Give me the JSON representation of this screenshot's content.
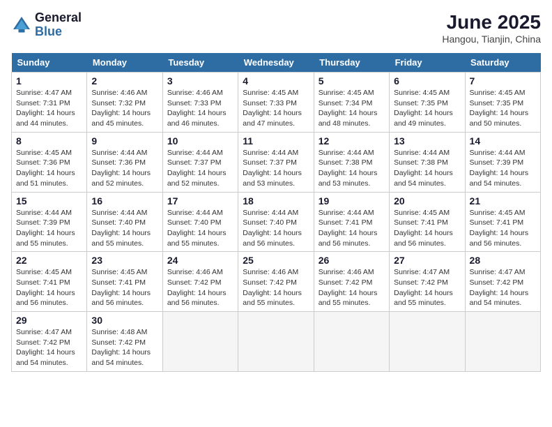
{
  "header": {
    "logo_line1": "General",
    "logo_line2": "Blue",
    "month": "June 2025",
    "location": "Hangou, Tianjin, China"
  },
  "weekdays": [
    "Sunday",
    "Monday",
    "Tuesday",
    "Wednesday",
    "Thursday",
    "Friday",
    "Saturday"
  ],
  "weeks": [
    [
      {
        "day": "1",
        "info": "Sunrise: 4:47 AM\nSunset: 7:31 PM\nDaylight: 14 hours\nand 44 minutes."
      },
      {
        "day": "2",
        "info": "Sunrise: 4:46 AM\nSunset: 7:32 PM\nDaylight: 14 hours\nand 45 minutes."
      },
      {
        "day": "3",
        "info": "Sunrise: 4:46 AM\nSunset: 7:33 PM\nDaylight: 14 hours\nand 46 minutes."
      },
      {
        "day": "4",
        "info": "Sunrise: 4:45 AM\nSunset: 7:33 PM\nDaylight: 14 hours\nand 47 minutes."
      },
      {
        "day": "5",
        "info": "Sunrise: 4:45 AM\nSunset: 7:34 PM\nDaylight: 14 hours\nand 48 minutes."
      },
      {
        "day": "6",
        "info": "Sunrise: 4:45 AM\nSunset: 7:35 PM\nDaylight: 14 hours\nand 49 minutes."
      },
      {
        "day": "7",
        "info": "Sunrise: 4:45 AM\nSunset: 7:35 PM\nDaylight: 14 hours\nand 50 minutes."
      }
    ],
    [
      {
        "day": "8",
        "info": "Sunrise: 4:45 AM\nSunset: 7:36 PM\nDaylight: 14 hours\nand 51 minutes."
      },
      {
        "day": "9",
        "info": "Sunrise: 4:44 AM\nSunset: 7:36 PM\nDaylight: 14 hours\nand 52 minutes."
      },
      {
        "day": "10",
        "info": "Sunrise: 4:44 AM\nSunset: 7:37 PM\nDaylight: 14 hours\nand 52 minutes."
      },
      {
        "day": "11",
        "info": "Sunrise: 4:44 AM\nSunset: 7:37 PM\nDaylight: 14 hours\nand 53 minutes."
      },
      {
        "day": "12",
        "info": "Sunrise: 4:44 AM\nSunset: 7:38 PM\nDaylight: 14 hours\nand 53 minutes."
      },
      {
        "day": "13",
        "info": "Sunrise: 4:44 AM\nSunset: 7:38 PM\nDaylight: 14 hours\nand 54 minutes."
      },
      {
        "day": "14",
        "info": "Sunrise: 4:44 AM\nSunset: 7:39 PM\nDaylight: 14 hours\nand 54 minutes."
      }
    ],
    [
      {
        "day": "15",
        "info": "Sunrise: 4:44 AM\nSunset: 7:39 PM\nDaylight: 14 hours\nand 55 minutes."
      },
      {
        "day": "16",
        "info": "Sunrise: 4:44 AM\nSunset: 7:40 PM\nDaylight: 14 hours\nand 55 minutes."
      },
      {
        "day": "17",
        "info": "Sunrise: 4:44 AM\nSunset: 7:40 PM\nDaylight: 14 hours\nand 55 minutes."
      },
      {
        "day": "18",
        "info": "Sunrise: 4:44 AM\nSunset: 7:40 PM\nDaylight: 14 hours\nand 56 minutes."
      },
      {
        "day": "19",
        "info": "Sunrise: 4:44 AM\nSunset: 7:41 PM\nDaylight: 14 hours\nand 56 minutes."
      },
      {
        "day": "20",
        "info": "Sunrise: 4:45 AM\nSunset: 7:41 PM\nDaylight: 14 hours\nand 56 minutes."
      },
      {
        "day": "21",
        "info": "Sunrise: 4:45 AM\nSunset: 7:41 PM\nDaylight: 14 hours\nand 56 minutes."
      }
    ],
    [
      {
        "day": "22",
        "info": "Sunrise: 4:45 AM\nSunset: 7:41 PM\nDaylight: 14 hours\nand 56 minutes."
      },
      {
        "day": "23",
        "info": "Sunrise: 4:45 AM\nSunset: 7:41 PM\nDaylight: 14 hours\nand 56 minutes."
      },
      {
        "day": "24",
        "info": "Sunrise: 4:46 AM\nSunset: 7:42 PM\nDaylight: 14 hours\nand 56 minutes."
      },
      {
        "day": "25",
        "info": "Sunrise: 4:46 AM\nSunset: 7:42 PM\nDaylight: 14 hours\nand 55 minutes."
      },
      {
        "day": "26",
        "info": "Sunrise: 4:46 AM\nSunset: 7:42 PM\nDaylight: 14 hours\nand 55 minutes."
      },
      {
        "day": "27",
        "info": "Sunrise: 4:47 AM\nSunset: 7:42 PM\nDaylight: 14 hours\nand 55 minutes."
      },
      {
        "day": "28",
        "info": "Sunrise: 4:47 AM\nSunset: 7:42 PM\nDaylight: 14 hours\nand 54 minutes."
      }
    ],
    [
      {
        "day": "29",
        "info": "Sunrise: 4:47 AM\nSunset: 7:42 PM\nDaylight: 14 hours\nand 54 minutes."
      },
      {
        "day": "30",
        "info": "Sunrise: 4:48 AM\nSunset: 7:42 PM\nDaylight: 14 hours\nand 54 minutes."
      },
      null,
      null,
      null,
      null,
      null
    ]
  ]
}
